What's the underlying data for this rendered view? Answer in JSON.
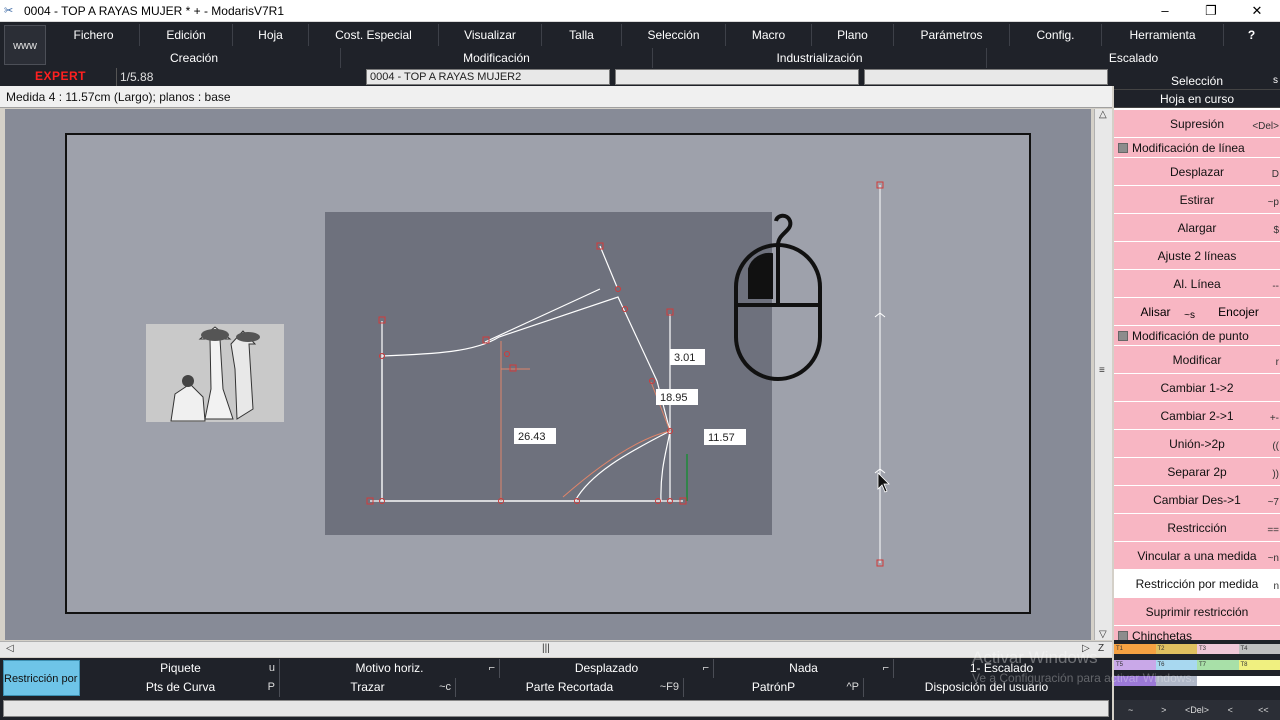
{
  "window": {
    "title": "0004 - TOP A RAYAS MUJER * + - ModarisV7R1",
    "controls": [
      "–",
      "❐",
      "✕"
    ]
  },
  "menu": {
    "www": "www",
    "row1": [
      "Fichero",
      "Edición",
      "Hoja",
      "Cost. Especial",
      "Visualizar",
      "Talla",
      "Selección",
      "Macro",
      "Plano",
      "Parámetros",
      "Config.",
      "Herramienta",
      "?"
    ],
    "row2": [
      "Creación",
      "Modificación",
      "Industrialización",
      "Escalado"
    ]
  },
  "status": {
    "mode": "EXPERT",
    "scale": "1/5.88",
    "piece_name": "0004 - TOP A RAYAS MUJER2",
    "field2": "",
    "field3": ""
  },
  "infobar": {
    "text": "Medida 4 : 11.57cm (Largo);    planos :  base"
  },
  "canvas": {
    "labels": [
      "3.01",
      "18.95",
      "26.43",
      "11.57"
    ]
  },
  "right_panel": {
    "header1": "Selección",
    "header1_shortcut": "s",
    "header2": "Hoja en curso",
    "items": [
      {
        "type": "item",
        "label": "Supresión",
        "shortcut": "<Del>"
      },
      {
        "type": "section",
        "label": "Modificación de línea"
      },
      {
        "type": "item",
        "label": "Desplazar",
        "shortcut": "D"
      },
      {
        "type": "item",
        "label": "Estirar",
        "shortcut": "~p"
      },
      {
        "type": "item",
        "label": "Alargar",
        "shortcut": "$"
      },
      {
        "type": "item",
        "label": "Ajuste 2 líneas",
        "shortcut": ""
      },
      {
        "type": "item",
        "label": "Al. Línea",
        "shortcut": "--"
      },
      {
        "type": "split",
        "left": "Alisar",
        "left_shortcut": "~s",
        "right": "Encojer"
      },
      {
        "type": "section",
        "label": "Modificación de punto"
      },
      {
        "type": "item",
        "label": "Modificar",
        "shortcut": "r"
      },
      {
        "type": "item",
        "label": "Cambiar 1->2",
        "shortcut": ""
      },
      {
        "type": "item",
        "label": "Cambiar 2->1",
        "shortcut": "+-"
      },
      {
        "type": "item",
        "label": "Unión->2p",
        "shortcut": "(("
      },
      {
        "type": "item",
        "label": "Separar 2p",
        "shortcut": "))"
      },
      {
        "type": "item",
        "label": "Cambiar Des->1",
        "shortcut": "~7"
      },
      {
        "type": "item",
        "label": "Restricción",
        "shortcut": "=="
      },
      {
        "type": "item",
        "label": "Vincular a una medida",
        "shortcut": "~n"
      },
      {
        "type": "item",
        "label": "Restricción por medida",
        "shortcut": "n",
        "active": true
      },
      {
        "type": "item",
        "label": "Suprimir restricción",
        "shortcut": ""
      },
      {
        "type": "section",
        "label": "Chinchetas"
      }
    ]
  },
  "bottom": {
    "active_tool": "Restricción por medida",
    "row1": [
      {
        "label": "Piquete",
        "key": "u"
      },
      {
        "label": "Motivo horiz.",
        "key": "⌐"
      },
      {
        "label": "Desplazado",
        "key": "⌐"
      },
      {
        "label": "Nada",
        "key": "⌐"
      },
      {
        "label": "1- Escalado",
        "key": ""
      }
    ],
    "row2": [
      {
        "label": "Pts de Curva",
        "key": "P"
      },
      {
        "label": "Trazar",
        "key": "~c"
      },
      {
        "label": "Parte Recortada",
        "key": "~F9"
      },
      {
        "label": "PatrónP",
        "key": "^P"
      },
      {
        "label": "Disposición del usuario",
        "key": ""
      }
    ],
    "swatches_row1": [
      "T1",
      "T2",
      "T3",
      "T4"
    ],
    "swatches_row2": [
      "T5",
      "T6",
      "T7",
      "T8"
    ],
    "br_buttons": [
      "~",
      ">",
      "<Del>",
      "<",
      "<<"
    ]
  },
  "watermark": {
    "line1": "Activar Windows",
    "line2": "Ve a Configuración para activar Windows."
  },
  "colors": {
    "menu_bg": "#1f2229",
    "pink_button": "#f8b6c3",
    "active_blue": "#6ec4e8",
    "canvas_bg": "#878b97",
    "expert_red": "#ff2020"
  }
}
